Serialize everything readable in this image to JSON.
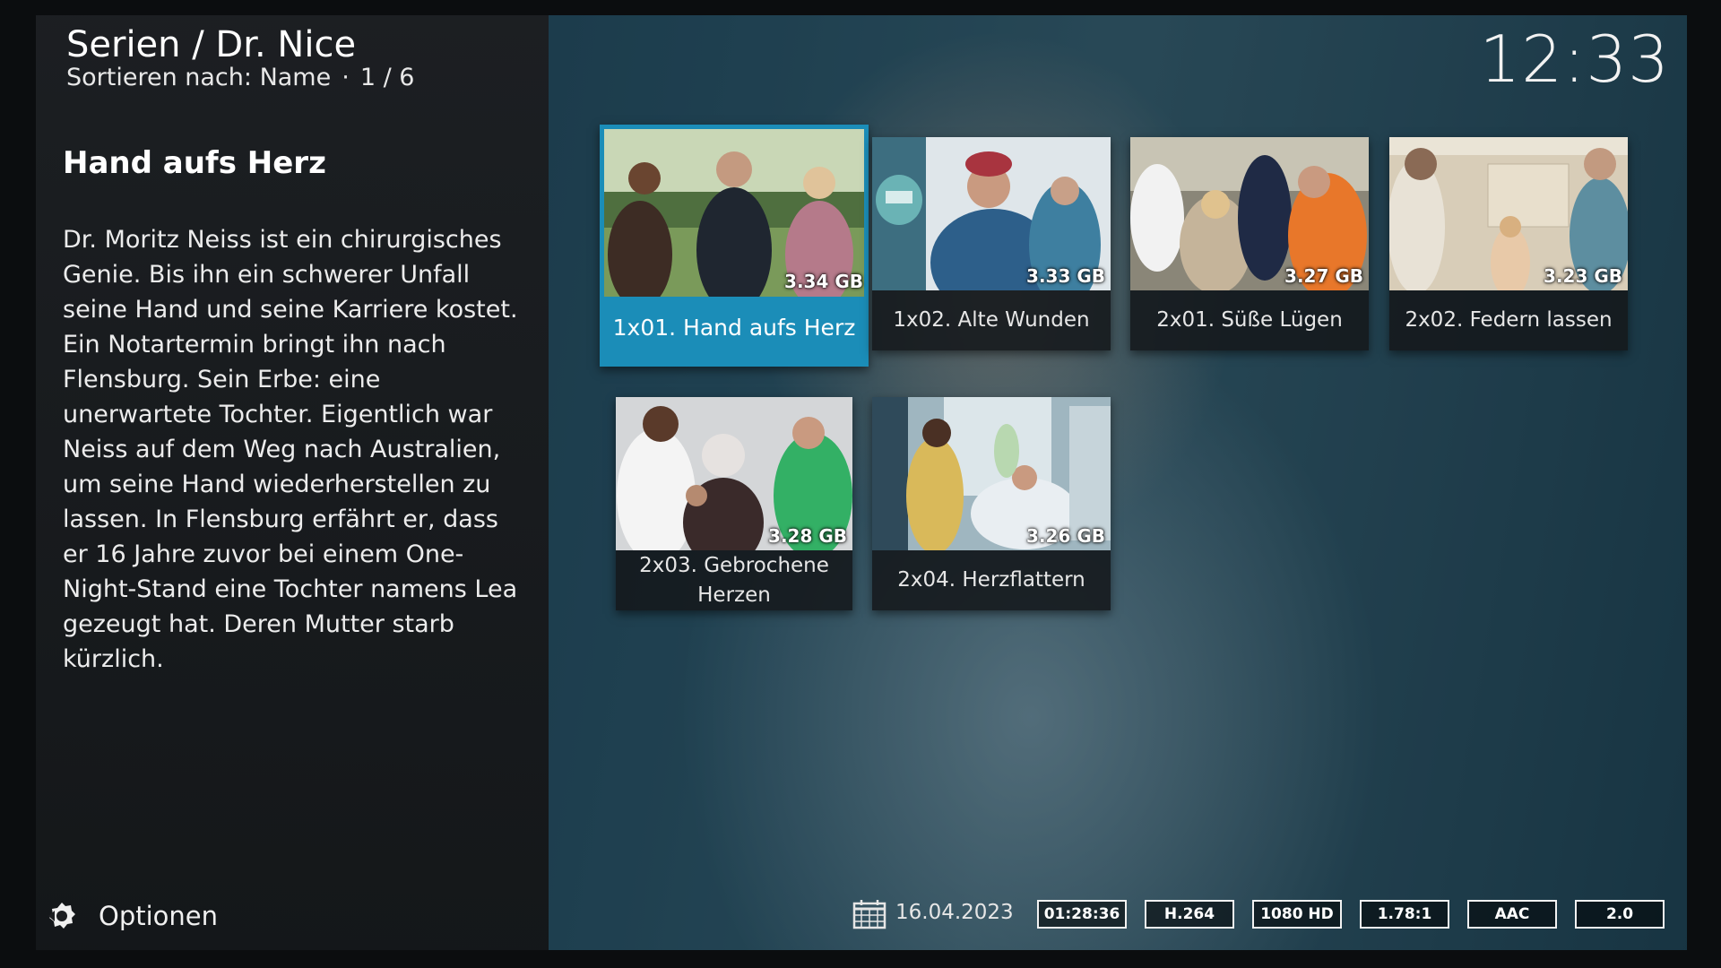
{
  "header": {
    "title": "Serien / Dr. Nice",
    "sort_label": "Sortieren nach: Name",
    "separator": "·",
    "position": "1 / 6"
  },
  "clock": "12:33",
  "selected": {
    "title": "Hand aufs Herz",
    "plot": "Dr. Moritz Neiss ist ein chirurgisches Genie. Bis ihn ein schwerer Unfall seine Hand und seine Karriere kostet. Ein Notartermin bringt ihn nach Flensburg. Sein Erbe: eine unerwartete Tochter. Eigentlich war Neiss auf dem Weg nach Australien, um seine Hand wiederherstellen zu lassen. In Flensburg erfährt er, dass er 16 Jahre zuvor bei einem One-Night-Stand eine Tochter namens Lea gezeugt hat. Deren Mutter starb kürzlich."
  },
  "episodes": [
    {
      "label": "1x01. Hand aufs Herz",
      "size": "3.34 GB",
      "focused": true
    },
    {
      "label": "1x02. Alte Wunden",
      "size": "3.33 GB",
      "focused": false
    },
    {
      "label": "2x01. Süße Lügen",
      "size": "3.27 GB",
      "focused": false
    },
    {
      "label": "2x02. Federn lassen",
      "size": "3.23 GB",
      "focused": false
    },
    {
      "label": "2x03. Gebrochene Herzen",
      "size": "3.28 GB",
      "focused": false
    },
    {
      "label": "2x04. Herzflattern",
      "size": "3.26 GB",
      "focused": false
    }
  ],
  "options": {
    "label": "Optionen",
    "icon": "options-gear-icon"
  },
  "info": {
    "date": "16.04.2023",
    "duration": "01:28:36",
    "video_codec": "H.264",
    "resolution": "1080 HD",
    "aspect": "1.78:1",
    "audio_codec": "AAC",
    "channels": "2.0"
  },
  "colors": {
    "focus": "#1b8db8",
    "panel": "#1c1e21"
  }
}
